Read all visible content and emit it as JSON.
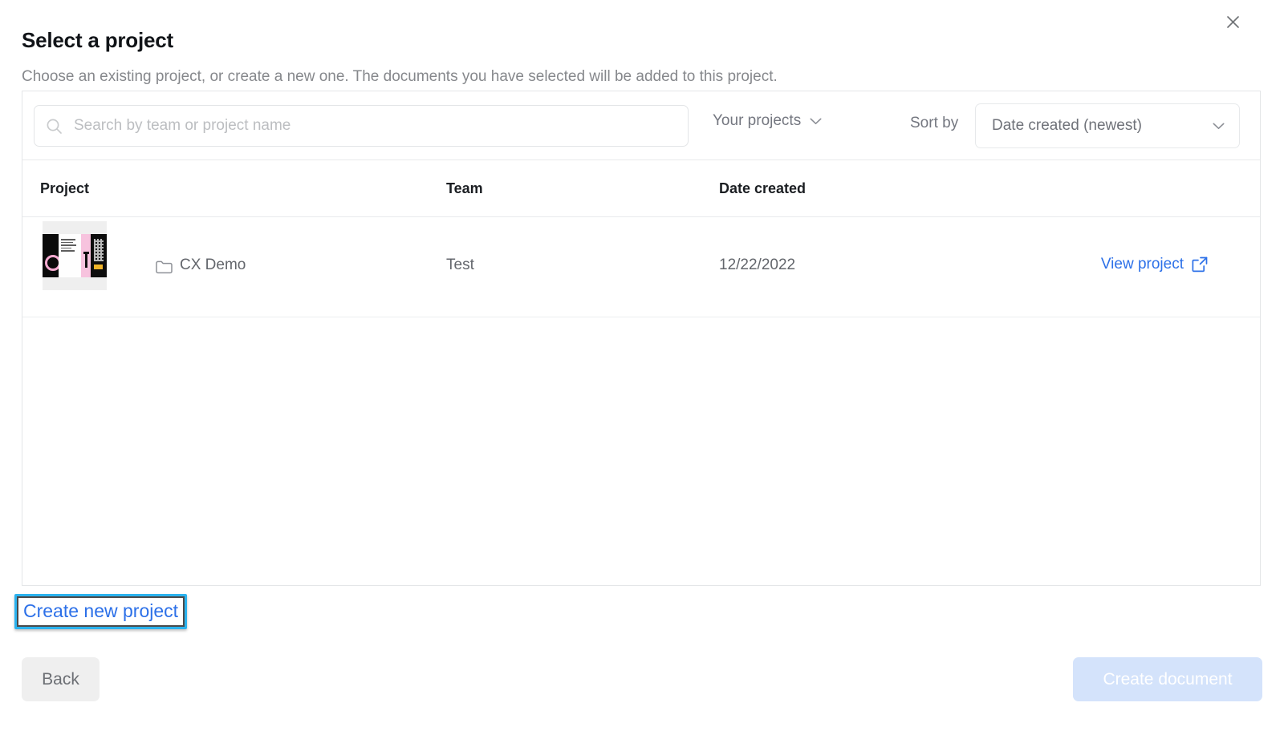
{
  "dialog": {
    "title": "Select a project",
    "subtitle": "Choose an existing project, or create a new one. The documents you have selected will be added to this project.",
    "close_label": "×"
  },
  "toolbar": {
    "search_placeholder": "Search by team or project name",
    "search_value": "",
    "search_icon": "search-icon",
    "scope_label": "Your projects",
    "scope_icon": "chevron-down-icon",
    "sort_by_label": "Sort by",
    "sort_value": "Date created (newest)",
    "sort_icon": "chevron-down-icon"
  },
  "table": {
    "columns": [
      "Project",
      "Team",
      "Date created"
    ],
    "rows": [
      {
        "project": "CX Demo",
        "team": "Test",
        "date_created": "12/22/2022",
        "action_label": "View project",
        "action_icon": "external-link-icon",
        "folder_icon": "folder-icon",
        "thumbnail_alt": "project-thumbnail"
      }
    ]
  },
  "actions": {
    "create_new_project": "Create new project",
    "back": "Back",
    "create_document": "Create document"
  },
  "colors": {
    "link_blue": "#2c70e8",
    "focus_ring": "#2bb3ef",
    "primary_disabled": "#d4e3fb",
    "back_button_bg": "#efefef",
    "border": "#e4e6e8",
    "text_primary": "#111418",
    "text_muted": "#86888c"
  }
}
